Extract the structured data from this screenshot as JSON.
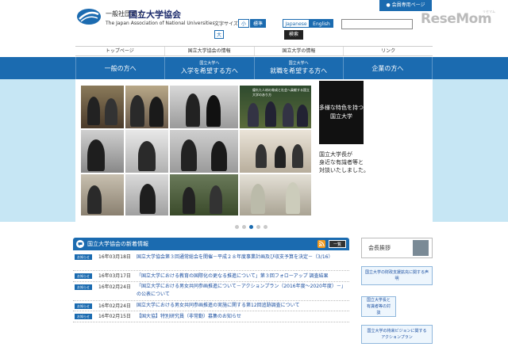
{
  "header": {
    "org_small": "一般社団法人",
    "org_name": "国立大学協会",
    "org_en": "The Japan Association of National Universities",
    "font_size_label": "文字サイズ",
    "font_small": "小",
    "font_standard": "標準",
    "font_large": "大",
    "lang_japanese": "Japanese",
    "lang_english": "English",
    "search_button": "検索",
    "search_placeholder": "",
    "member_page": "● 会員専用ページ",
    "watermark": "ReseMom",
    "watermark_sub": "リセマム"
  },
  "top_nav": [
    "トップページ",
    "国立大学協会の情報",
    "国立大学の情報",
    "リンク"
  ],
  "blue_nav": [
    {
      "small": "",
      "label": "一般の方へ"
    },
    {
      "small": "国立大学へ",
      "label": "入学を希望する方へ"
    },
    {
      "small": "国立大学へ",
      "label": "就職を希望する方へ"
    },
    {
      "small": "",
      "label": "企業の方へ"
    }
  ],
  "hero": {
    "feature_line1": "多様な特色を持つ",
    "feature_line2": "国立大学",
    "caption_line1": "国立大学長が",
    "caption_line2": "身近な有識者等と",
    "caption_line3": "対談いたしました。",
    "photo_caption": "優れた人材の育成と社会へ貢献する国立大学のあり方"
  },
  "carousel": {
    "count": 5,
    "active": 3
  },
  "news": {
    "title": "国立大学協会の新着情報",
    "list_button": "一覧",
    "items": [
      {
        "badge": "お知らせ",
        "date": "16年03月18日",
        "text": "国立大学協会第３回通常総会を開催－平成２８年度事業計画及び収支予算を決定－（3/16）",
        "two": true
      },
      {
        "badge": "お知らせ",
        "date": "16年03月17日",
        "text": "「国立大学における教育の国際化の更なる推進について」第３回フォローアップ 調査結果",
        "two": false
      },
      {
        "badge": "お知らせ",
        "date": "16年02月24日",
        "text": "「国立大学における男女共同参画推進について－アクションプラン（2016年度～2020年度）－」の公表について",
        "two": true
      },
      {
        "badge": "お知らせ",
        "date": "16年02月24日",
        "text": "国立大学における男女共同参画推進の実施に関する第12回追跡調査について",
        "two": false
      },
      {
        "badge": "お知らせ",
        "date": "16年02月15日",
        "text": "【国大協】特別研究員（非常勤）募集のお知らせ",
        "two": false
      }
    ]
  },
  "sidebar": {
    "kaicho": "会長挨拶",
    "link1": "国立大学の財政支援拡充に関する声明",
    "link2": "国立大学長と有識者等の対談",
    "link3": "国立大学の将来ビジョンに関するアクションプラン"
  },
  "colors": {
    "primary": "#1b6bb0",
    "hero_bg": "#c6e6f4",
    "rss": "#f39a1e"
  }
}
